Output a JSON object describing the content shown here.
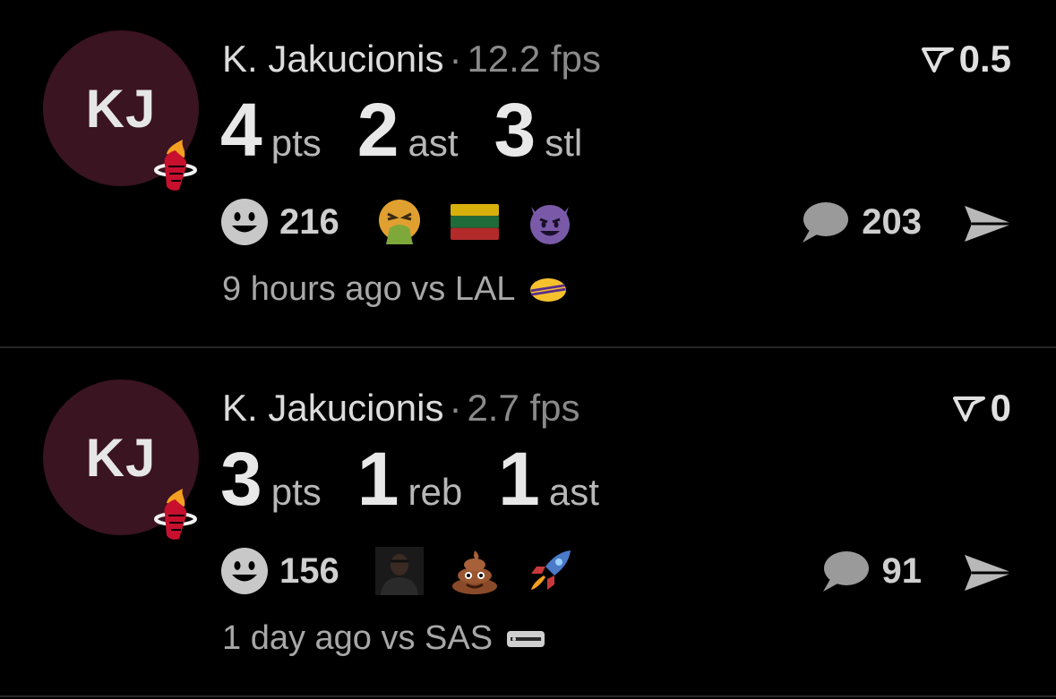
{
  "posts": [
    {
      "avatar_initials": "KJ",
      "team_logo": "miami-heat-logo",
      "player": "K. Jakucionis",
      "separator": "·",
      "fps": "12.2 fps",
      "vote_score": "0.5",
      "stats": [
        {
          "value": "4",
          "unit": "pts"
        },
        {
          "value": "2",
          "unit": "ast"
        },
        {
          "value": "3",
          "unit": "stl"
        }
      ],
      "reaction_count": "216",
      "reactions": [
        "vomiting-face-emoji",
        "lithuania-flag-emoji",
        "smiling-devil-emoji"
      ],
      "comment_count": "203",
      "time_ago": "9 hours ago vs LAL",
      "opponent_logo": "lakers-logo"
    },
    {
      "avatar_initials": "KJ",
      "team_logo": "miami-heat-logo",
      "player": "K. Jakucionis",
      "separator": "·",
      "fps": "2.7 fps",
      "vote_score": "0",
      "stats": [
        {
          "value": "3",
          "unit": "pts"
        },
        {
          "value": "1",
          "unit": "reb"
        },
        {
          "value": "1",
          "unit": "ast"
        }
      ],
      "reaction_count": "156",
      "reactions": [
        "person-photo-emoji",
        "poop-emoji",
        "rocket-emoji"
      ],
      "comment_count": "91",
      "time_ago": "1 day ago vs SAS",
      "opponent_logo": "spurs-logo"
    }
  ],
  "colors": {
    "background": "#000000",
    "avatar_bg": "#3a1420",
    "divider": "#262626",
    "muted_text": "#8a8a8a"
  }
}
